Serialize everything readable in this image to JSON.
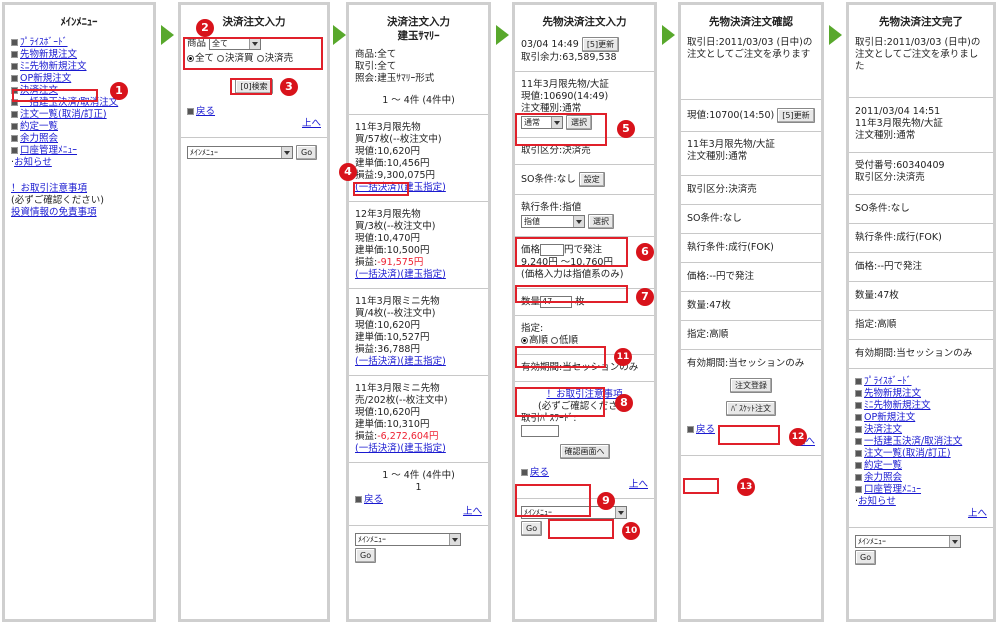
{
  "colors": {
    "highlight": "#e0202a",
    "badge": "#d8131b",
    "arrow": "#58a82c",
    "link": "#1a1ad0",
    "loss": "#e22233"
  },
  "badges": [
    "1",
    "2",
    "3",
    "4",
    "5",
    "6",
    "7",
    "8",
    "9",
    "10",
    "11",
    "12",
    "13"
  ],
  "p1": {
    "title": "ﾒｲﾝﾒﾆｭｰ",
    "links": [
      "ﾌﾟﾗｲｽﾎﾞｰﾄﾞ",
      "先物新規注文",
      "ﾐﾆ先物新規注文",
      "OP新規注文",
      "決済注文",
      "一括建玉決済/取消注文",
      "注文一覧(取消/訂正)",
      "約定一覧",
      "余力照会",
      "口座管理ﾒﾆｭｰ"
    ],
    "notice": "お知らせ",
    "caution_link": "！お取引注意事項",
    "caution_note": "(必ずご確認ください)",
    "disclaimer": "投資情報の免責事項"
  },
  "p2": {
    "title": "決済注文入力",
    "product_label": "商品",
    "product_value": "全て",
    "radios": [
      "全て",
      "決済買",
      "決済売"
    ],
    "search_btn": "[0]検索",
    "back": "戻る",
    "top": "上へ",
    "menu_select": "ﾒｲﾝﾒﾆｭｰ",
    "go": "Go"
  },
  "p3": {
    "title": "決済注文入力",
    "subtitle": "建玉ｻﾏﾘｰ",
    "summary": [
      "商品:全て",
      "取引:全て",
      "照会:建玉ｻﾏﾘｰ形式"
    ],
    "count": "1 ～ 4件 (4件中)",
    "positions": [
      {
        "name": "11年3月限先物",
        "side": "買/57枚(--枚注文中)",
        "now": "現値:10,620円",
        "build": "建単価:10,456円",
        "pnl_label": "損益:",
        "pnl": "9,300,075円",
        "loss": false
      },
      {
        "name": "12年3月限先物",
        "side": "買/3枚(--枚注文中)",
        "now": "現値:10,470円",
        "build": "建単価:10,500円",
        "pnl_label": "損益:",
        "pnl": "-91,575円",
        "loss": true
      },
      {
        "name": "11年3月限ミニ先物",
        "side": "買/4枚(--枚注文中)",
        "now": "現値:10,620円",
        "build": "建単価:10,527円",
        "pnl_label": "損益:",
        "pnl": "36,788円",
        "loss": false
      },
      {
        "name": "11年3月限ミニ先物",
        "side": "売/202枚(--枚注文中)",
        "now": "現値:10,620円",
        "build": "建単価:10,310円",
        "pnl_label": "損益:",
        "pnl": "-6,272,604円",
        "loss": true
      }
    ],
    "settle_all": "(一括決済)",
    "settle_spec": "(建玉指定)",
    "page": "1",
    "back": "戻る",
    "top": "上へ",
    "menu_select": "ﾒｲﾝﾒﾆｭｰ",
    "go": "Go"
  },
  "p4": {
    "title": "先物決済注文入力",
    "datetime": "03/04 14:49",
    "refresh": "[5]更新",
    "margin": "取引余力:63,589,538",
    "product": "11年3月限先物/大証",
    "price": "現値:10690(14:49)",
    "order_type_label": "注文種別:通常",
    "order_type_value": "通常",
    "select": "選択",
    "trade_type": "取引区分:決済売",
    "so": "SO条件:なし",
    "so_btn": "設定",
    "exec_label": "執行条件:指値",
    "exec_value": "指値",
    "price_label": "価格",
    "price_suffix": "円で発注",
    "price_range": "9,240円 ～10,760円",
    "price_note": "(価格入力は指値系のみ)",
    "qty_label": "数量",
    "qty_value": "47",
    "qty_unit": "枚",
    "spec_label": "指定:",
    "spec_opts": [
      "高順",
      "低順"
    ],
    "validity": "有効期間:当セッションのみ",
    "caution_link": "！お取引注意事項",
    "caution_note": "(必ずご確認ください)",
    "password_label": "取引ﾊﾟｽﾜｰﾄﾞ:",
    "confirm_btn": "確認画面へ",
    "back": "戻る",
    "top": "上へ",
    "menu_select": "ﾒｲﾝﾒﾆｭｰ",
    "go": "Go"
  },
  "p5": {
    "title": "先物決済注文確認",
    "trade_date": "取引日:2011/03/03 (日中)の注文としてご注文を承ります",
    "price": "現値:10700(14:50)",
    "refresh": "[5]更新",
    "product": "11年3月限先物/大証",
    "order_type": "注文種別:通常",
    "trade_type": "取引区分:決済売",
    "so": "SO条件:なし",
    "exec": "執行条件:成行(FOK)",
    "price_line": "価格:--円で発注",
    "qty": "数量:47枚",
    "spec": "指定:高順",
    "validity": "有効期間:当セッションのみ",
    "submit_btn": "注文登録",
    "basket_btn": "ﾊﾞｽｹｯﾄ注文",
    "back": "戻る",
    "top": "上へ"
  },
  "p6": {
    "title": "先物決済注文完了",
    "trade_date": "取引日:2011/03/03 (日中)の注文としてご注文を承りました",
    "datetime": "2011/03/04 14:51",
    "product": "11年3月限先物/大証",
    "order_type": "注文種別:通常",
    "receipt": "受付番号:60340409",
    "trade_type": "取引区分:決済売",
    "so": "SO条件:なし",
    "exec": "執行条件:成行(FOK)",
    "price_line": "価格:--円で発注",
    "qty": "数量:47枚",
    "spec": "指定:高順",
    "validity": "有効期間:当セッションのみ",
    "links": [
      "ﾌﾟﾗｲｽﾎﾞｰﾄﾞ",
      "先物新規注文",
      "ﾐﾆ先物新規注文",
      "OP新規注文",
      "決済注文",
      "一括建玉決済/取消注文",
      "注文一覧(取消/訂正)",
      "約定一覧",
      "余力照会",
      "口座管理ﾒﾆｭｰ"
    ],
    "notice": "お知らせ",
    "top": "上へ",
    "menu_select": "ﾒｲﾝﾒﾆｭｰ",
    "go": "Go"
  }
}
